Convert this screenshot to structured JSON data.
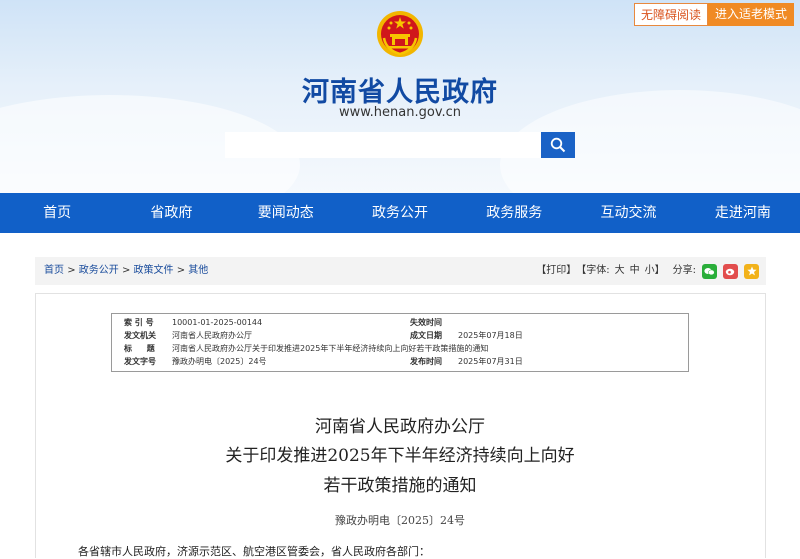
{
  "header": {
    "accessibility_button": "无障碍阅读",
    "elderly_mode_button": "进入适老模式",
    "site_title": "河南省人民政府",
    "site_url": "www.henan.gov.cn",
    "search_placeholder": ""
  },
  "nav": [
    "首页",
    "省政府",
    "要闻动态",
    "政务公开",
    "政务服务",
    "互动交流",
    "走进河南"
  ],
  "breadcrumb": {
    "home": "首页",
    "sep1": ">",
    "item1": "政务公开",
    "sep2": ">",
    "item2": "政策文件",
    "sep3": ">",
    "item3": "其他"
  },
  "tools": {
    "print": "【打印】",
    "font_label": "【字体:",
    "font_large": "大",
    "font_medium": "中",
    "font_small": "小",
    "font_close": "】",
    "share_label": "分享:"
  },
  "meta": {
    "index_label": "索 引 号",
    "index_value": "10001-01-2025-00144",
    "expire_label": "失效时间",
    "expire_value": "",
    "issuer_label": "发文机关",
    "issuer_value": "河南省人民政府办公厅",
    "written_label": "成文日期",
    "written_value": "2025年07月18日",
    "title_label": "标 题",
    "title_value": "河南省人民政府办公厅关于印发推进2025年下半年经济持续向上向好若干政策措施的通知",
    "docno_label": "发文字号",
    "docno_value": "豫政办明电〔2025〕24号",
    "publish_label": "发布时间",
    "publish_value": "2025年07月31日"
  },
  "document": {
    "title_line1": "河南省人民政府办公厅",
    "title_line2": "关于印发推进2025年下半年经济持续向上向好",
    "title_line3": "若干政策措施的通知",
    "doc_number": "豫政办明电〔2025〕24号",
    "salutation": "各省辖市人民政府，济源示范区、航空港区管委会，省人民政府各部门："
  },
  "colors": {
    "nav_blue": "#1160c8",
    "title_blue": "#114aa3",
    "orange": "#f08a24"
  }
}
